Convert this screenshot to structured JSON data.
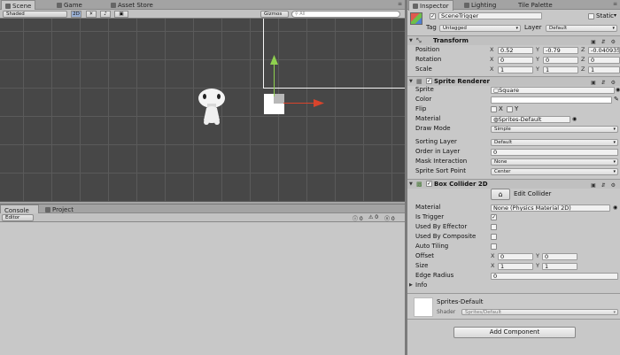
{
  "scene_tabs": [
    "Scene",
    "Game",
    "Asset Store"
  ],
  "scene_toolbar": {
    "shading": "Shaded",
    "mode_2d": "2D",
    "gizmos": "Gizmos",
    "search_placeholder": "All"
  },
  "console_tabs": [
    "Console",
    "Project"
  ],
  "console_toolbar": {
    "editor": "Editor",
    "count_info": "0",
    "count_warn": "0",
    "count_error": "0"
  },
  "inspector_tabs": [
    "Inspector",
    "Lighting",
    "Tile Palette"
  ],
  "object": {
    "name": "SceneTrigger",
    "static_label": "Static",
    "tag_label": "Tag",
    "tag": "Untagged",
    "layer_label": "Layer",
    "layer": "Default"
  },
  "transform": {
    "title": "Transform",
    "position": {
      "label": "Position",
      "x": "0.52",
      "y": "-0.79",
      "z": "-0.040935"
    },
    "rotation": {
      "label": "Rotation",
      "x": "0",
      "y": "0",
      "z": "0"
    },
    "scale": {
      "label": "Scale",
      "x": "1",
      "y": "1",
      "z": "1"
    }
  },
  "sprite_renderer": {
    "title": "Sprite Renderer",
    "sprite_label": "Sprite",
    "sprite": "Square",
    "color_label": "Color",
    "flip_label": "Flip",
    "flip_x": "X",
    "flip_y": "Y",
    "material_label": "Material",
    "material": "Sprites-Default",
    "draw_mode_label": "Draw Mode",
    "draw_mode": "Simple",
    "sorting_layer_label": "Sorting Layer",
    "sorting_layer": "Default",
    "order_label": "Order in Layer",
    "order": "0",
    "mask_label": "Mask Interaction",
    "mask": "None",
    "sort_point_label": "Sprite Sort Point",
    "sort_point": "Center"
  },
  "box_collider": {
    "title": "Box Collider 2D",
    "edit_collider": "Edit Collider",
    "material_label": "Material",
    "material": "None (Physics Material 2D)",
    "is_trigger_label": "Is Trigger",
    "used_by_effector_label": "Used By Effector",
    "used_by_composite_label": "Used By Composite",
    "auto_tiling_label": "Auto Tiling",
    "offset_label": "Offset",
    "offset_x": "0",
    "offset_y": "0",
    "size_label": "Size",
    "size_x": "1",
    "size_y": "1",
    "edge_radius_label": "Edge Radius",
    "edge_radius": "0",
    "info_label": "Info"
  },
  "material_preview": {
    "name": "Sprites-Default",
    "shader_label": "Shader",
    "shader": "Sprites/Default"
  },
  "add_component": "Add Component",
  "colors": {
    "scene_bg": "#474747",
    "panel_bg": "#c8c8c8",
    "gizmo_y": "#8fd14f",
    "gizmo_x": "#d9442c"
  }
}
